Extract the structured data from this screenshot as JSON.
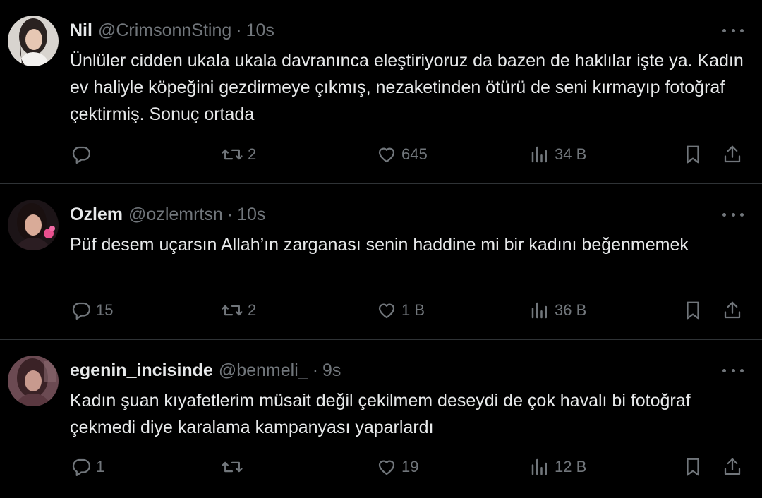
{
  "tweets": [
    {
      "name": "Nil",
      "handle": "@CrimsonnSting",
      "separator": "·",
      "time": "10s",
      "text": "Ünlüler cidden ukala ukala davranınca eleştiriyoruz da bazen de haklılar işte ya. Kadın ev haliyle köpeğini gezdirmeye çıkmış, nezaketinden ötürü de seni kırmayıp fotoğraf çektirmiş. Sonuç ortada",
      "reply_count": "",
      "retweet_count": "2",
      "like_count": "645",
      "view_count": "34 B"
    },
    {
      "name": "Ozlem",
      "handle": "@ozlemrtsn",
      "separator": "·",
      "time": "10s",
      "text": "Püf desem uçarsın Allah’ın zarganası senin haddine mi bir kadını beğenmemek",
      "reply_count": "15",
      "retweet_count": "2",
      "like_count": "1 B",
      "view_count": "36 B"
    },
    {
      "name": "egenin_incisinde",
      "handle": "@benmeli_",
      "separator": "·",
      "time": "9s",
      "text": "Kadın şuan kıyafetlerim müsait değil çekilmem deseydi de çok havalı bi fotoğraf çekmedi diye karalama kampanyası yaparlardı",
      "reply_count": "1",
      "retweet_count": "",
      "like_count": "19",
      "view_count": "12 B"
    }
  ],
  "icons": {
    "more": "more-icon",
    "reply": "reply-icon",
    "retweet": "retweet-icon",
    "like": "heart-icon",
    "views": "views-icon",
    "bookmark": "bookmark-icon",
    "share": "share-icon"
  },
  "colors": {
    "background": "#000000",
    "text_primary": "#e7e9ea",
    "text_secondary": "#71767b",
    "divider": "#2f3336"
  }
}
